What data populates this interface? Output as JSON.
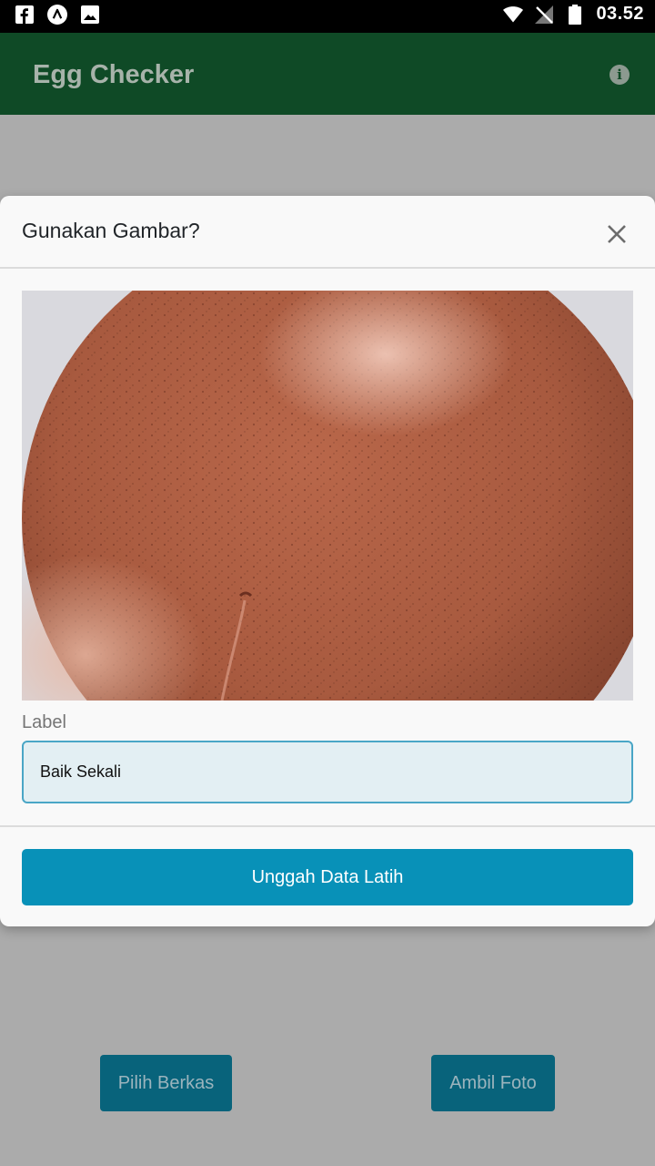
{
  "status_bar": {
    "time": "03.52",
    "icons": [
      "facebook-icon",
      "nav-app-icon",
      "gallery-icon",
      "wifi-icon",
      "no-signal-icon",
      "battery-icon"
    ]
  },
  "app_bar": {
    "title": "Egg Checker",
    "info_icon": "info-icon",
    "colors": {
      "background": "#0f4a26",
      "title": "#a7b3aa"
    }
  },
  "modal": {
    "title": "Gunakan Gambar?",
    "close_icon": "close-icon",
    "image_subject": "brown egg photo",
    "label_caption": "Label",
    "label_value": "Baik Sekali",
    "submit_label": "Unggah Data Latih",
    "colors": {
      "submit": "#0891b8",
      "input_border": "#4aa6c6",
      "input_bg": "#e3eff3"
    }
  },
  "background_buttons": {
    "pick_file": "Pilih Berkas",
    "take_photo": "Ambil Foto"
  }
}
